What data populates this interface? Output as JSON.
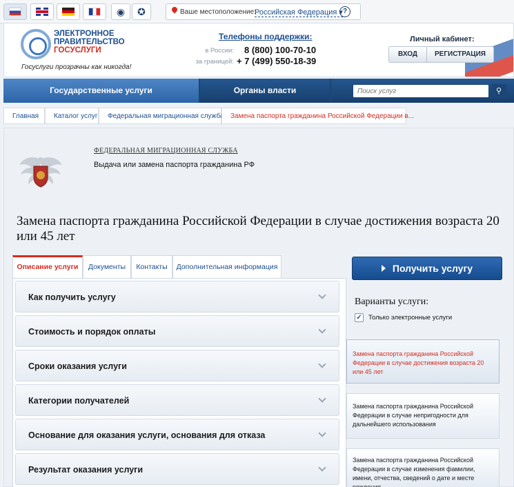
{
  "topbar": {
    "languages": [
      {
        "name": "ru-flag-icon"
      },
      {
        "name": "uk-flag-icon"
      },
      {
        "name": "de-flag-icon"
      },
      {
        "name": "fr-flag-icon"
      }
    ],
    "location_label": "Ваше местоположение:",
    "location_value": "Российская Федерация",
    "help": "?"
  },
  "header": {
    "logo_line1": "ЭЛЕКТРОННОЕ",
    "logo_line2": "ПРАВИТЕЛЬСТВО",
    "logo_line3": "ГОСУСЛУГИ",
    "slogan": "Госуслуги прозрачны как никогда!",
    "phones_title": "Телефоны поддержки:",
    "phone_ru_label": "в России:",
    "phone_ru": "8 (800) 100-70-10",
    "phone_abroad_label": "за границей:",
    "phone_abroad": "+ 7 (499) 550-18-39",
    "cabinet_title": "Личный кабинет:",
    "login": "ВХОД",
    "register": "РЕГИСТРАЦИЯ"
  },
  "nav": {
    "items": [
      "Государственные услуги",
      "Органы власти"
    ],
    "search_placeholder": "Поиск услуг"
  },
  "breadcrumbs": [
    "Главная",
    "Каталог услуг",
    "Федеральная миграционная служба",
    "Замена паспорта гражданина Российской Федерации в..."
  ],
  "main": {
    "department": "ФЕДЕРАЛЬНАЯ МИГРАЦИОННАЯ СЛУЖБА",
    "subtitle": "Выдача или замена паспорта гражданина РФ",
    "title": "Замена паспорта гражданина Российской Федерации в случае достижения возраста 20 или 45 лет",
    "tabs": [
      "Описание услуги",
      "Документы",
      "Контакты",
      "Дополнительная информация"
    ],
    "accordion": [
      "Как получить услугу",
      "Стоимость и порядок оплаты",
      "Сроки оказания услуги",
      "Категории получателей",
      "Основание для оказания услуги, основания для отказа",
      "Результат оказания услуги"
    ]
  },
  "side": {
    "get_button": "Получить услугу",
    "variants_title": "Варианты услуги:",
    "only_electronic": "Только электронные услуги",
    "only_electronic_checked": true,
    "variants": [
      "Замена паспорта гражданина Российской Федерации в случае достижения возраста 20 или 45 лет",
      "Замена паспорта гражданина Российской Федерации в случае непригодности для дальнейшего использования",
      "Замена паспорта гражданина Российской Федерации в случае изменения фамилии, имени, отчества, сведений о дате и месте рождения"
    ]
  },
  "colors": {
    "accent_red": "#d52b1e",
    "brand_blue": "#1d4f91",
    "nav_blue": "#2c64a8"
  }
}
